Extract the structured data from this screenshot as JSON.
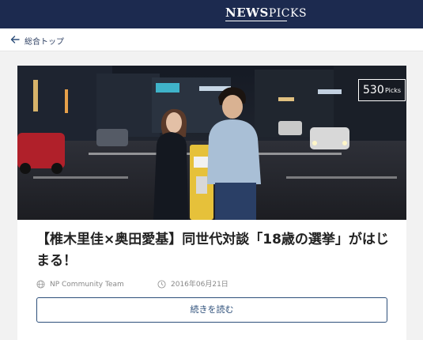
{
  "header": {
    "logo_text": "NEWSPICKS",
    "logo_part1": "NEWS",
    "logo_part2": "PICKS"
  },
  "nav": {
    "back_label": "総合トップ"
  },
  "article": {
    "picks_count": "530",
    "picks_unit": "Picks",
    "title": "【椎木里佳×奥田愛基】同世代対談「18歳の選挙」がはじまる！",
    "author": "NP Community Team",
    "date": "2016年06月21日",
    "read_more_label": "続きを読む"
  },
  "colors": {
    "header_bg": "#1c2a4f",
    "accent": "#2d4f7a"
  }
}
